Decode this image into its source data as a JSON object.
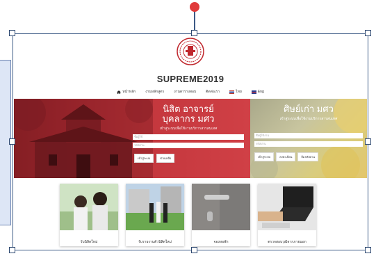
{
  "site": {
    "title": "SUPREME2019",
    "logo_text": "มหาวิทยาลัย"
  },
  "nav": {
    "items": [
      {
        "label": "หน้าหลัก",
        "icon": "home-icon"
      },
      {
        "label": "งานหลักสูตร"
      },
      {
        "label": "งานตารางสอบ"
      },
      {
        "label": "ติดต่อเรา"
      },
      {
        "label": "ไทย",
        "icon": "thai-flag-icon"
      },
      {
        "label": "Eng",
        "icon": "uk-flag-icon"
      }
    ]
  },
  "hero_left": {
    "title_line1": "นิสิต อาจารย์",
    "title_line2": "บุคลากร มศว",
    "subtitle": "เข้าสู่ระบบเพื่อใช้งานบริการสารสนเทศ",
    "username_placeholder": "ชื่อผู้ใช้",
    "password_placeholder": "รหัสผ่าน",
    "login_label": "เข้าสู่ระบบ",
    "help_label": "ช่วยเหลือ"
  },
  "hero_right": {
    "title": "ศิษย์เก่า มศว",
    "subtitle": "เข้าสู่ระบบเพื่อใช้งานบริการสารสนเทศ",
    "username_placeholder": "ชื่อผู้ใช้งาน",
    "password_placeholder": "รหัสผ่าน",
    "login_label": "เข้าสู่ระบบ",
    "register_label": "ลงทะเบียน",
    "forgot_label": "ลืมรหัสผ่าน"
  },
  "cards": [
    {
      "label": "รับนิสิตใหม่"
    },
    {
      "label": "รับรายงานตัวนิสิตใหม่"
    },
    {
      "label": "จองหอพัก"
    },
    {
      "label": "ตรวจสอบวุฒิจากภายนอก"
    }
  ],
  "colors": {
    "accent_red": "#c5383e",
    "frame_blue": "#3c5a86",
    "rotate_handle": "#e03a3a"
  }
}
